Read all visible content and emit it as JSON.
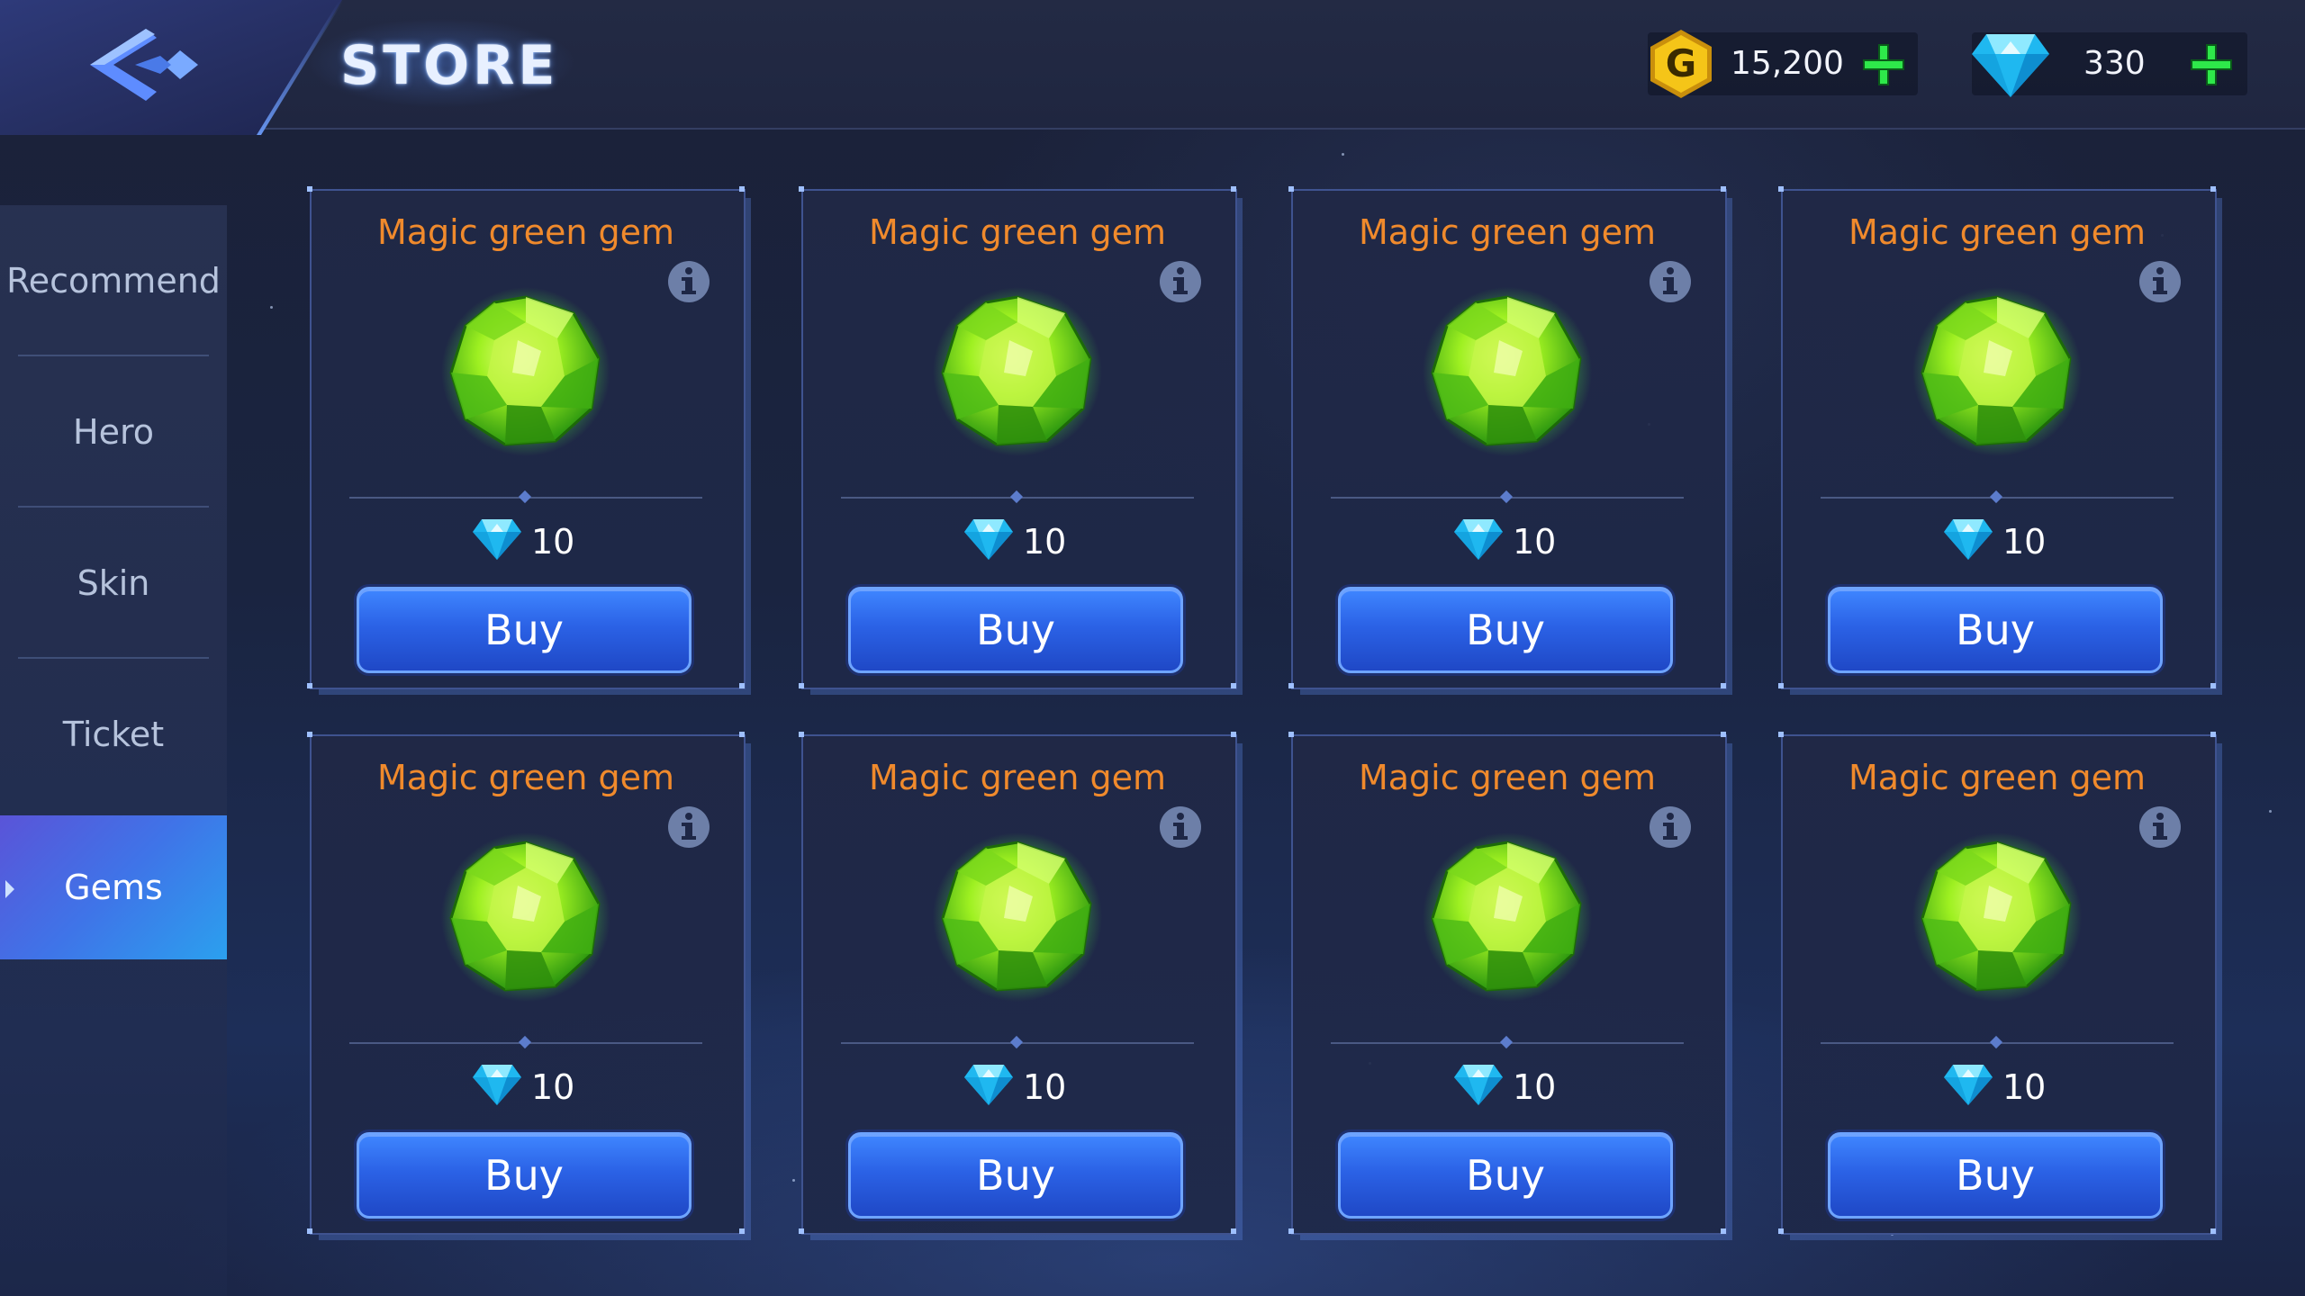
{
  "header": {
    "title": "STORE",
    "back_icon": "back-chevron-icon",
    "currencies": [
      {
        "name": "gold",
        "icon": "gold-coin-icon",
        "symbol": "G",
        "value": "15,200"
      },
      {
        "name": "diamond",
        "icon": "diamond-icon",
        "value": "330"
      }
    ]
  },
  "sidebar": {
    "items": [
      {
        "label": "Recommend",
        "active": false
      },
      {
        "label": "Hero",
        "active": false
      },
      {
        "label": "Skin",
        "active": false
      },
      {
        "label": "Ticket",
        "active": false
      },
      {
        "label": "Gems",
        "active": true
      }
    ]
  },
  "products": [
    {
      "name": "Magic green gem",
      "price": "10",
      "buy_label": "Buy",
      "currency_icon": "diamond-icon"
    },
    {
      "name": "Magic green gem",
      "price": "10",
      "buy_label": "Buy",
      "currency_icon": "diamond-icon"
    },
    {
      "name": "Magic green gem",
      "price": "10",
      "buy_label": "Buy",
      "currency_icon": "diamond-icon"
    },
    {
      "name": "Magic green gem",
      "price": "10",
      "buy_label": "Buy",
      "currency_icon": "diamond-icon"
    },
    {
      "name": "Magic green gem",
      "price": "10",
      "buy_label": "Buy",
      "currency_icon": "diamond-icon"
    },
    {
      "name": "Magic green gem",
      "price": "10",
      "buy_label": "Buy",
      "currency_icon": "diamond-icon"
    },
    {
      "name": "Magic green gem",
      "price": "10",
      "buy_label": "Buy",
      "currency_icon": "diamond-icon"
    },
    {
      "name": "Magic green gem",
      "price": "10",
      "buy_label": "Buy",
      "currency_icon": "diamond-icon"
    }
  ],
  "colors": {
    "product_title": "#f08a2c",
    "buy_button": "#2b62e6",
    "active_tab": "#3f74e8",
    "gold": "#f5c518",
    "diamond": "#2fd3ff",
    "plus": "#2ee84a"
  }
}
